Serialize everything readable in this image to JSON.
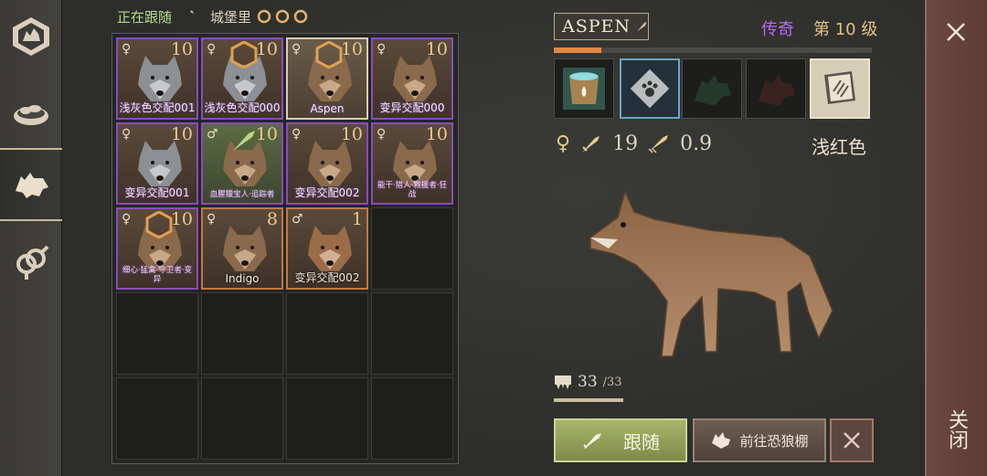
{
  "header": {
    "status": "正在跟随",
    "location": "城堡里"
  },
  "sidebar": {
    "items": [
      {
        "name": "pack-tab",
        "icon": "wolf-crest-icon"
      },
      {
        "name": "food-tab",
        "icon": "food-bowl-icon"
      },
      {
        "name": "wolves-tab",
        "icon": "wolf-silhouette-icon",
        "active": true
      },
      {
        "name": "breeding-tab",
        "icon": "gender-rings-icon"
      }
    ]
  },
  "grid": {
    "cells": [
      {
        "gender": "♀",
        "level": "10",
        "name": "浅灰色交配001",
        "fur": "gray",
        "frame": "purple"
      },
      {
        "gender": "♀",
        "level": "10",
        "name": "浅灰色交配000",
        "fur": "gray",
        "frame": "purple",
        "badge": true
      },
      {
        "gender": "♀",
        "level": "10",
        "name": "Aspen",
        "fur": "brown",
        "frame": "selected",
        "badge": true
      },
      {
        "gender": "♀",
        "level": "10",
        "name": "变异交配000",
        "fur": "brown",
        "frame": "purple"
      },
      {
        "gender": "♀",
        "level": "10",
        "name": "变异交配001",
        "fur": "gray",
        "frame": "purple"
      },
      {
        "gender": "♂",
        "level": "10",
        "name": "血腥獵宝人·追踪者",
        "fur": "brown",
        "frame": "purple",
        "following": true,
        "small": true
      },
      {
        "gender": "♀",
        "level": "10",
        "name": "变异交配002",
        "fur": "brown",
        "frame": "purple"
      },
      {
        "gender": "♀",
        "level": "10",
        "name": "能干·猎人·救援者·狂战",
        "fur": "brown",
        "frame": "purple",
        "small": true
      },
      {
        "gender": "♀",
        "level": "10",
        "name": "细心·猛禽·守卫者·变异",
        "fur": "brown",
        "frame": "purple",
        "badge": true,
        "small": true
      },
      {
        "gender": "♀",
        "level": "8",
        "name": "Indigo",
        "fur": "brown",
        "frame": "orange",
        "white": true
      },
      {
        "gender": "♂",
        "level": "1",
        "name": "变异交配002",
        "fur": "pup",
        "frame": "orange",
        "white": true
      }
    ],
    "empty_count": 9
  },
  "detail": {
    "name": "Aspen",
    "rarity": "传奇",
    "level_text": "第 10 级",
    "xp_fraction": 0.15,
    "gender": "♀",
    "attack": "19",
    "speed": "0.9",
    "color_name": "浅红色",
    "hunger_current": "33",
    "hunger_max": "/33",
    "hunger_fraction": 1.0,
    "skills": [
      {
        "icon": "water-bucket-icon",
        "state": "normal"
      },
      {
        "icon": "paw-plate-icon",
        "state": "active"
      },
      {
        "icon": "wolf-shadow-green-icon",
        "state": "locked"
      },
      {
        "icon": "wolf-shadow-red-icon",
        "state": "locked"
      },
      {
        "icon": "claw-book-icon",
        "state": "book"
      }
    ]
  },
  "actions": {
    "follow_label": "跟随",
    "den_label": "前往恐狼棚"
  },
  "close": {
    "label": "关闭"
  },
  "colors": {
    "legendary": "#b56cf0",
    "level_gold": "#e6c27e",
    "xp": "#e28845",
    "follow_btn": "#a8b56a",
    "close_strip": "#6b4a42"
  }
}
